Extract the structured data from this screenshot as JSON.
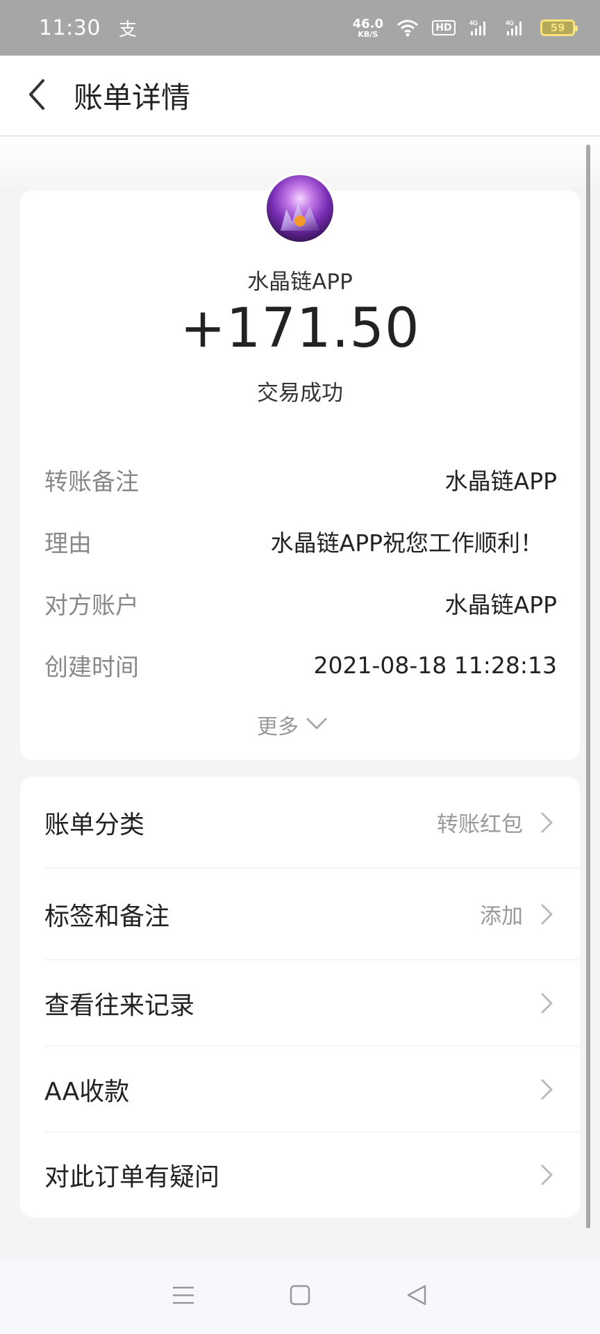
{
  "status_bar": {
    "time": "11:30",
    "app_icon": "支",
    "net_speed_value": "46.0",
    "net_speed_unit": "KB/S",
    "hd_label": "HD",
    "battery": "59"
  },
  "header": {
    "title": "账单详情"
  },
  "transaction": {
    "payee": "水晶链APP",
    "amount": "+171.50",
    "status": "交易成功"
  },
  "details": [
    {
      "label": "转账备注",
      "value": "水晶链APP"
    },
    {
      "label": "理由",
      "value": "水晶链APP祝您工作顺利！"
    },
    {
      "label": "对方账户",
      "value": "水晶链APP"
    },
    {
      "label": "创建时间",
      "value": "2021-08-18 11:28:13"
    }
  ],
  "more_label": "更多",
  "menu": [
    {
      "label": "账单分类",
      "value": "转账红包"
    },
    {
      "label": "标签和备注",
      "value": "添加"
    },
    {
      "label": "查看往来记录",
      "value": ""
    },
    {
      "label": "AA收款",
      "value": ""
    },
    {
      "label": "对此订单有疑问",
      "value": ""
    }
  ],
  "colors": {
    "status_bar_bg": "#a6a6a6",
    "card_bg": "#ffffff",
    "page_bg": "#f4f4f4",
    "label_gray": "#888888",
    "text_dark": "#222222"
  },
  "icons": {
    "back": "chevron-left-icon",
    "row_arrow": "chevron-right-icon",
    "more": "chevron-down-icon",
    "nav_menu": "menu-icon",
    "nav_home": "home-square-icon",
    "nav_back": "back-triangle-icon"
  }
}
